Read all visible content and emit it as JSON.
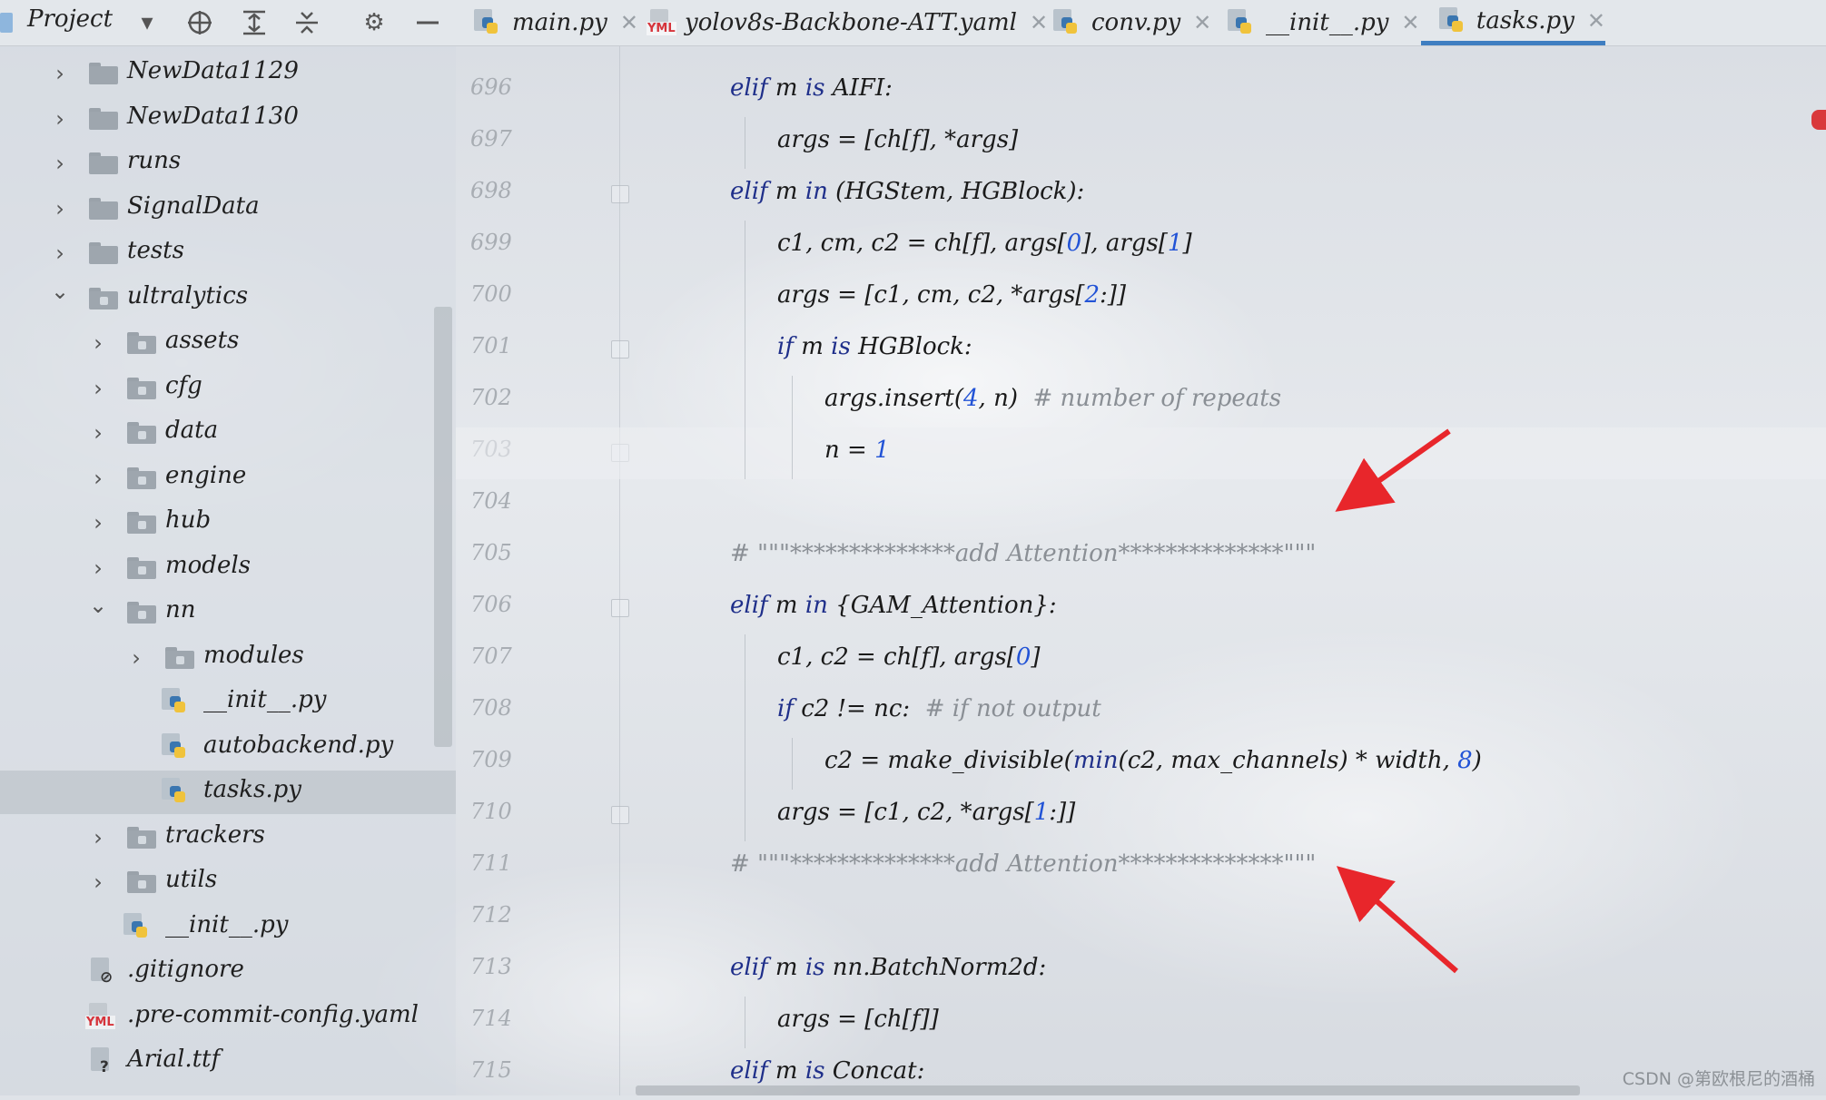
{
  "project_header": {
    "title": "Project"
  },
  "tabs": [
    {
      "label": "main.py",
      "icon": "python-file-icon",
      "active": false
    },
    {
      "label": "yolov8s-Backbone-ATT.yaml",
      "icon": "yaml-file-icon",
      "active": false
    },
    {
      "label": "conv.py",
      "icon": "python-file-icon",
      "active": false
    },
    {
      "label": "__init__.py",
      "icon": "python-file-icon",
      "active": false
    },
    {
      "label": "tasks.py",
      "icon": "python-file-icon",
      "active": true
    }
  ],
  "tree": [
    {
      "label": "NewData1129",
      "type": "folder",
      "expanded": false
    },
    {
      "label": "NewData1130",
      "type": "folder",
      "expanded": false
    },
    {
      "label": "runs",
      "type": "folder",
      "expanded": false
    },
    {
      "label": "SignalData",
      "type": "folder",
      "expanded": false
    },
    {
      "label": "tests",
      "type": "folder",
      "expanded": false
    },
    {
      "label": "ultralytics",
      "type": "folder",
      "expanded": true
    },
    {
      "label": "assets",
      "type": "folder",
      "expanded": false
    },
    {
      "label": "cfg",
      "type": "folder",
      "expanded": false
    },
    {
      "label": "data",
      "type": "folder",
      "expanded": false
    },
    {
      "label": "engine",
      "type": "folder",
      "expanded": false
    },
    {
      "label": "hub",
      "type": "folder",
      "expanded": false
    },
    {
      "label": "models",
      "type": "folder",
      "expanded": false
    },
    {
      "label": "nn",
      "type": "folder",
      "expanded": true
    },
    {
      "label": "modules",
      "type": "folder",
      "expanded": false
    },
    {
      "label": "__init__.py",
      "type": "python"
    },
    {
      "label": "autobackend.py",
      "type": "python"
    },
    {
      "label": "tasks.py",
      "type": "python",
      "selected": true
    },
    {
      "label": "trackers",
      "type": "folder",
      "expanded": false
    },
    {
      "label": "utils",
      "type": "folder",
      "expanded": false
    },
    {
      "label": "__init__.py",
      "type": "python"
    },
    {
      "label": ".gitignore",
      "type": "ignore"
    },
    {
      "label": ".pre-commit-config.yaml",
      "type": "yaml"
    },
    {
      "label": "Arial.ttf",
      "type": "unknown"
    }
  ],
  "line_numbers": [
    "696",
    "697",
    "698",
    "699",
    "700",
    "701",
    "702",
    "703",
    "704",
    "705",
    "706",
    "707",
    "708",
    "709",
    "710",
    "711",
    "712",
    "713",
    "714",
    "715"
  ],
  "code_lines": [
    [
      {
        "t": "elif",
        "k": "kw"
      },
      {
        "t": " m "
      },
      {
        "t": "is",
        "k": "kw"
      },
      {
        "t": " AIFI:"
      }
    ],
    [
      {
        "t": "args = [ch[f], *args]"
      }
    ],
    [
      {
        "t": "elif",
        "k": "kw"
      },
      {
        "t": " m "
      },
      {
        "t": "in",
        "k": "kw"
      },
      {
        "t": " (HGStem, HGBlock):"
      }
    ],
    [
      {
        "t": "c1, cm, c2 = ch[f], args["
      },
      {
        "t": "0",
        "k": "num"
      },
      {
        "t": "], args["
      },
      {
        "t": "1",
        "k": "num"
      },
      {
        "t": "]"
      }
    ],
    [
      {
        "t": "args = [c1, cm, c2, *args["
      },
      {
        "t": "2",
        "k": "num"
      },
      {
        "t": ":]]"
      }
    ],
    [
      {
        "t": "if",
        "k": "kw"
      },
      {
        "t": " m "
      },
      {
        "t": "is",
        "k": "kw"
      },
      {
        "t": " HGBlock:"
      }
    ],
    [
      {
        "t": "args.insert("
      },
      {
        "t": "4",
        "k": "num"
      },
      {
        "t": ", n)  "
      },
      {
        "t": "# number of repeats",
        "k": "cm"
      }
    ],
    [
      {
        "t": "n = "
      },
      {
        "t": "1",
        "k": "num"
      }
    ],
    [],
    [
      {
        "t": "# \"\"\"**************add Attention**************\"\"\"",
        "k": "cm"
      }
    ],
    [
      {
        "t": "elif",
        "k": "kw"
      },
      {
        "t": " m "
      },
      {
        "t": "in",
        "k": "kw"
      },
      {
        "t": " {GAM_Attention}:"
      }
    ],
    [
      {
        "t": "c1, c2 = ch[f], args["
      },
      {
        "t": "0",
        "k": "num"
      },
      {
        "t": "]"
      }
    ],
    [
      {
        "t": "if",
        "k": "kw"
      },
      {
        "t": " c2 != nc:  "
      },
      {
        "t": "# if not output",
        "k": "cm"
      }
    ],
    [
      {
        "t": "c2 = make_divisible("
      },
      {
        "t": "min",
        "k": "kw"
      },
      {
        "t": "(c2, max_channels) * width, "
      },
      {
        "t": "8",
        "k": "num"
      },
      {
        "t": ")"
      }
    ],
    [
      {
        "t": "args = [c1, c2, *args["
      },
      {
        "t": "1",
        "k": "num"
      },
      {
        "t": ":]]"
      }
    ],
    [
      {
        "t": "# \"\"\"**************add Attention**************\"\"\"",
        "k": "cm"
      }
    ],
    [],
    [
      {
        "t": "elif",
        "k": "kw"
      },
      {
        "t": " m "
      },
      {
        "t": "is",
        "k": "kw"
      },
      {
        "t": " nn.BatchNorm2d:"
      }
    ],
    [
      {
        "t": "args = [ch[f]]"
      }
    ],
    [
      {
        "t": "elif",
        "k": "kw"
      },
      {
        "t": " m "
      },
      {
        "t": "is",
        "k": "kw"
      },
      {
        "t": " Concat:"
      }
    ]
  ],
  "colors": {
    "keyword": "#1f2f8a",
    "number": "#2253d6",
    "comment": "#8a8f95",
    "tab_active_underline": "#3f7ec1",
    "annotation_arrow": "#e8262b"
  },
  "watermark": "CSDN @第欧根尼的酒桶"
}
